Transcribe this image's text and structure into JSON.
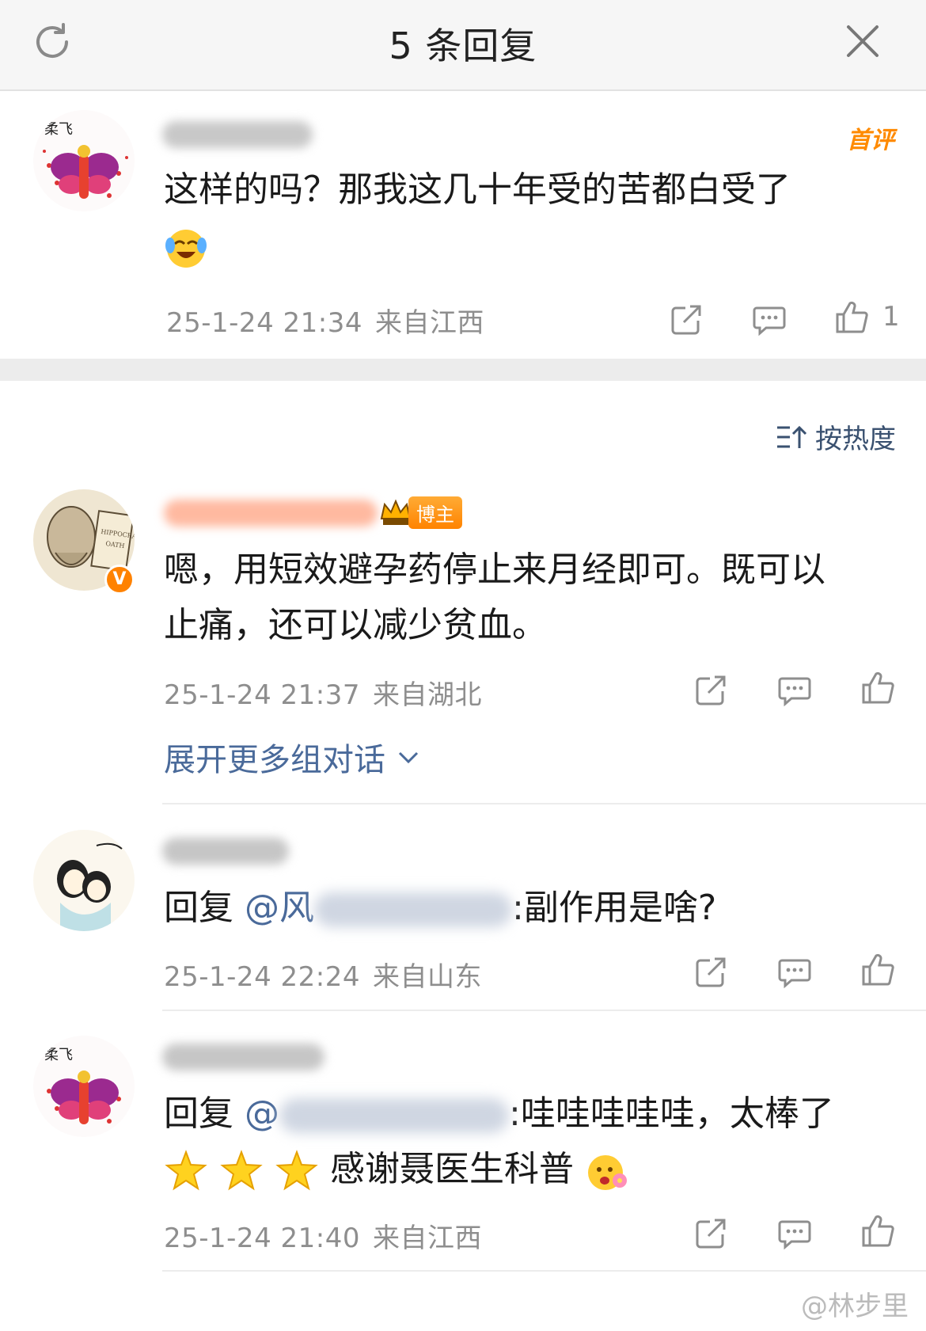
{
  "header": {
    "title": "5 条回复",
    "refresh_icon": "refresh-icon",
    "close_icon": "close-icon"
  },
  "top_comment": {
    "badge": "首评",
    "text": "这样的吗？那我这几十年受的苦都白受了",
    "emoji": "laughing-crying-emoji",
    "time": "25-1-24 21:34",
    "location": "来自江西",
    "like_count": "1"
  },
  "sort": {
    "label": "按热度"
  },
  "replies": [
    {
      "badge": "博主",
      "verified": "V",
      "text_line1": "嗯，用短效避孕药停止来月经即可。既可以",
      "text_line2": "止痛，还可以减少贫血。",
      "time": "25-1-24 21:37",
      "location": "来自湖北"
    },
    {
      "reply_prefix": "回复",
      "mention_prefix": "@风",
      "text": ":副作用是啥?",
      "time": "25-1-24 22:24",
      "location": "来自山东"
    },
    {
      "reply_prefix": "回复",
      "mention_prefix": "@",
      "text": ":哇哇哇哇哇，太棒了",
      "text_line2": "感谢聂医生科普",
      "time": "25-1-24 21:40",
      "location": "来自江西"
    }
  ],
  "expand_label": "展开更多组对话",
  "watermark": "@林步里",
  "colors": {
    "accent_link": "#4a6a9a",
    "badge_orange": "#ff8a00",
    "meta_gray": "#8e8e8e"
  }
}
